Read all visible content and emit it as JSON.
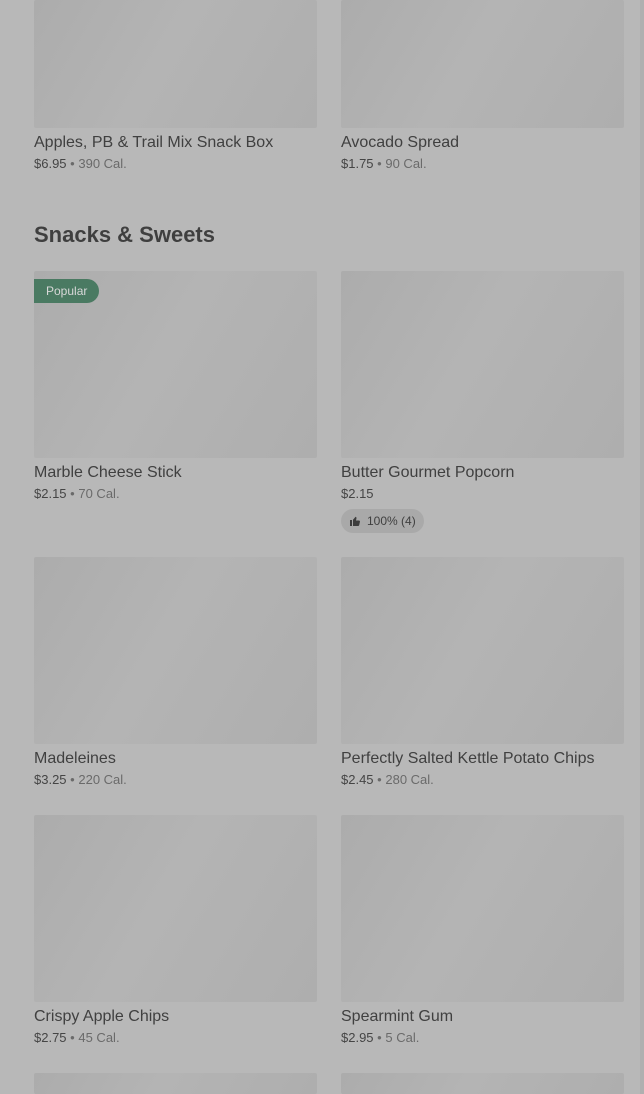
{
  "section": {
    "title": "Snacks & Sweets"
  },
  "items": [
    {
      "name": "Apples, PB & Trail Mix Snack Box",
      "price": "$6.95",
      "separator": "•",
      "calories": "390 Cal."
    },
    {
      "name": "Avocado Spread",
      "price": "$1.75",
      "separator": "•",
      "calories": "90 Cal."
    },
    {
      "name": "Marble Cheese Stick",
      "price": "$2.15",
      "separator": "•",
      "calories": "70 Cal.",
      "badge": "Popular"
    },
    {
      "name": "Butter Gourmet Popcorn",
      "price": "$2.15",
      "rating": "100% (4)",
      "rating_icon": "thumbs-up-icon"
    },
    {
      "name": "Madeleines",
      "price": "$3.25",
      "separator": "•",
      "calories": "220 Cal."
    },
    {
      "name": "Perfectly Salted Kettle Potato Chips",
      "price": "$2.45",
      "separator": "•",
      "calories": "280 Cal."
    },
    {
      "name": "Crispy Apple Chips",
      "price": "$2.75",
      "separator": "•",
      "calories": "45 Cal."
    },
    {
      "name": "Spearmint Gum",
      "price": "$2.95",
      "separator": "•",
      "calories": "5 Cal."
    }
  ],
  "colors": {
    "overlay_background": "#b8b8b8",
    "badge_background": "#4a7a62",
    "image_placeholder": "#afafaf"
  }
}
